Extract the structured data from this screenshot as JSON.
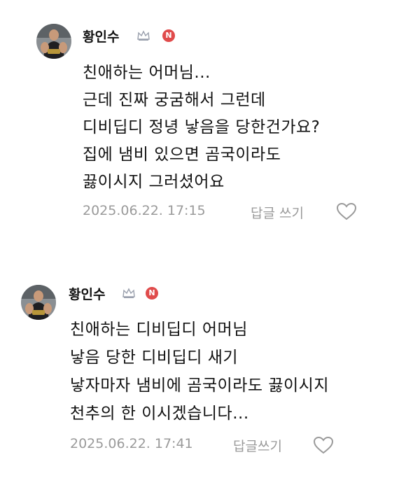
{
  "comments": [
    {
      "username": "황인수",
      "badge": "N",
      "lines": [
        "친애하는 어머님...",
        "근데 진짜 궁굼해서 그런데",
        "디비딥디 정녕 낳음을 당한건가요?",
        "집에 냄비 있으면 곰국이라도",
        "끓이시지 그러셨어요"
      ],
      "timestamp": "2025.06.22. 17:15",
      "reply_label": "답글 쓰기",
      "like_icon": "heart-outline-icon"
    },
    {
      "username": "황인수",
      "badge": "N",
      "lines": [
        "친애하는 디비딥디 어머님",
        "낳음 당한 디비딥디 새기",
        "낳자마자 냄비에 곰국이라도 끓이시지",
        "천추의 한 이시겠습니다..."
      ],
      "timestamp": "2025.06.22. 17:41",
      "reply_label": "답글쓰기",
      "like_icon": "heart-outline-icon"
    }
  ],
  "colors": {
    "text": "#111111",
    "meta": "#9a9a9a",
    "badge": "#e04b4b"
  }
}
